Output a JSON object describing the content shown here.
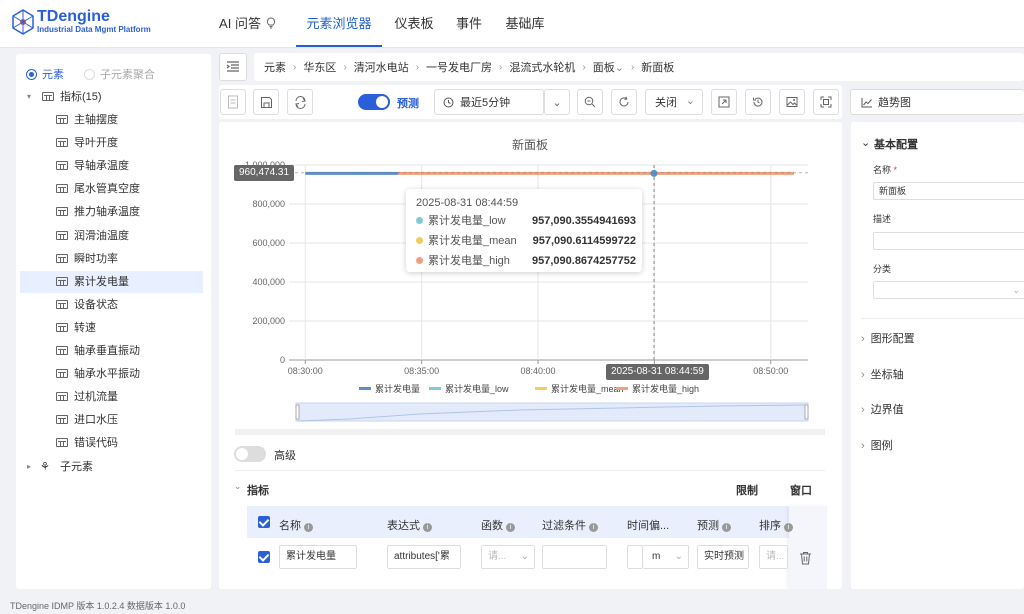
{
  "app": {
    "logo_title": "TDengine",
    "logo_subtitle": "Industrial Data Mgmt Platform",
    "nav_tabs": [
      "AI 问答",
      "元素浏览器",
      "仪表板",
      "事件",
      "基础库"
    ],
    "active_tab": "元素浏览器",
    "accent": "#1f5fd9"
  },
  "sidebar": {
    "radio_elements": "元素",
    "radio_aggregate": "子元素聚合",
    "metrics_group": "指标(15)",
    "items": [
      "主轴摆度",
      "导叶开度",
      "导轴承温度",
      "尾水管真空度",
      "推力轴承温度",
      "润滑油温度",
      "瞬时功率",
      "累计发电量",
      "设备状态",
      "转速",
      "轴承垂直振动",
      "轴承水平振动",
      "过机流量",
      "进口水压",
      "错误代码"
    ],
    "selected_item": "累计发电量",
    "children_group": "子元素"
  },
  "breadcrumb": [
    "元素",
    "华东区",
    "清河水电站",
    "一号发电厂房",
    "混流式水轮机",
    "面板",
    "新面板"
  ],
  "toolbar": {
    "predict_label": "预测",
    "time_range": "最近5分钟",
    "refresh_option": "关闭",
    "trend_label": "趋势图"
  },
  "chart_data": {
    "type": "line",
    "title": "新面板",
    "x_ticks": [
      "08:30:00",
      "08:35:00",
      "08:40:00",
      "08:45:00",
      "08:50:00"
    ],
    "y_ticks": [
      "0",
      "200,000",
      "400,000",
      "600,000",
      "800,000",
      "1,000,000"
    ],
    "ylim": [
      0,
      1000000
    ],
    "series": [
      {
        "name": "累计发电量",
        "color": "#5b8fc7",
        "x_range": [
          "08:30:00",
          "08:34:00"
        ],
        "value": 957090
      },
      {
        "name": "累计发电量_low",
        "color": "#7ecbd6",
        "value": 957090.3554941693
      },
      {
        "name": "累计发电量_mean",
        "color": "#f5cc5a",
        "value": 957090.6114599722
      },
      {
        "name": "累计发电量_high",
        "color": "#f0a07c",
        "x_range": [
          "08:34:00",
          "08:51:00"
        ],
        "value": 957090.8674257752
      }
    ],
    "crosshair_y_label": "960,474.31",
    "crosshair_x_label": "2025-08-31 08:44:59",
    "tooltip": {
      "time": "2025-08-31 08:44:59",
      "rows": [
        {
          "name": "累计发电量_low",
          "value": "957,090.3554941693",
          "color": "#7ecbd6"
        },
        {
          "name": "累计发电量_mean",
          "value": "957,090.6114599722",
          "color": "#f5cc5a"
        },
        {
          "name": "累计发电量_high",
          "value": "957,090.8674257752",
          "color": "#f0a07c"
        }
      ]
    },
    "legend": [
      "累计发电量",
      "累计发电量_low",
      "累计发电量_mean",
      "累计发电量_high"
    ],
    "grid": true
  },
  "advanced": {
    "label": "高级"
  },
  "metrics_section": {
    "title": "指标",
    "limit_label": "限制",
    "window_label": "窗口",
    "columns": [
      "名称",
      "表达式",
      "函数",
      "过滤条件",
      "时间偏...",
      "预测",
      "排序"
    ],
    "row": {
      "name": "累计发电量",
      "expression": "attributes['累",
      "function_placeholder": "请...",
      "time_unit": "m",
      "predict": "实时预测",
      "sort_placeholder": "请..."
    }
  },
  "right_panel": {
    "basic_config": "基本配置",
    "name_label": "名称",
    "name_value": "新面板",
    "desc_label": "描述",
    "category_label": "分类",
    "sections": [
      "图形配置",
      "坐标轴",
      "边界值",
      "图例"
    ]
  },
  "footer": "TDengine IDMP 版本 1.0.2.4 数据版本 1.0.0"
}
